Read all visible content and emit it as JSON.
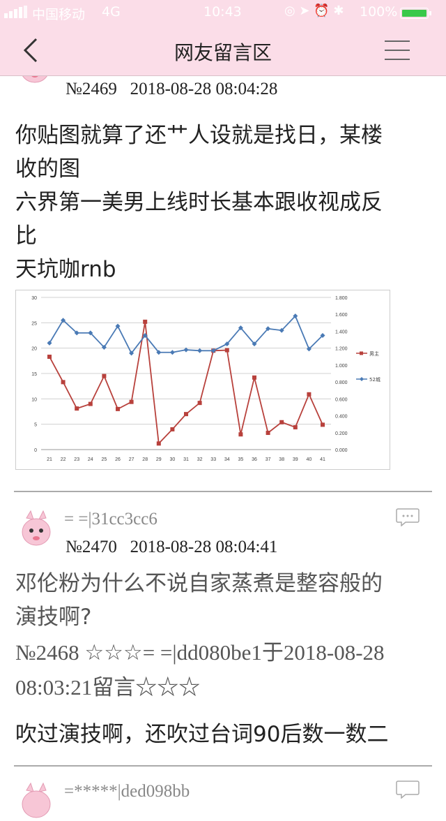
{
  "status_bar": {
    "carrier": "中国移动",
    "network": "4G",
    "time": "10:43",
    "battery": "100%"
  },
  "nav": {
    "title": "网友留言区",
    "back_icon": "chevron-left-icon",
    "menu_icon": "hamburger-menu-icon"
  },
  "posts": [
    {
      "number": "№2469",
      "timestamp": "2018-08-28 08:04:28",
      "lines": [
        "你贴图就算了还艹人设就是找日，某楼",
        "收的图",
        "六界第一美男上线时长基本跟收视成反",
        "比",
        "天坑咖rnb"
      ]
    },
    {
      "user": "= =|31cc3cc6",
      "number": "№2470",
      "timestamp": "2018-08-28 08:04:41",
      "lines": [
        "邓伦粉为什么不说自家蒸煮是整容般的",
        "演技啊?"
      ],
      "quote_lines": [
        "№2468 ☆☆☆= =|dd080be1于2018-08-28",
        "08:03:21留言☆☆☆"
      ],
      "reply": "吹过演技啊，还吹过台词90后数一数二"
    },
    {
      "user": "=*****|ded098bb"
    }
  ],
  "colors": {
    "header_bg": "#fbdde8",
    "series_male": "#b8413c",
    "series_52": "#4a7ab5"
  },
  "chart_data": {
    "type": "line",
    "x": [
      21,
      22,
      23,
      24,
      25,
      26,
      27,
      28,
      29,
      30,
      31,
      32,
      33,
      34,
      35,
      36,
      37,
      38,
      39,
      40,
      41
    ],
    "x_tick_labels": [
      "21",
      "22",
      "23",
      "24",
      "25",
      "26",
      "27",
      "28",
      "29",
      "30",
      "31",
      "32",
      "33",
      "34",
      "35",
      "36",
      "37",
      "38",
      "39",
      "40",
      "41"
    ],
    "y_left_ticks": [
      "30",
      "25",
      "20",
      "15",
      "10",
      "5",
      "0"
    ],
    "y_right_ticks": [
      "1.800",
      "1.600",
      "1.400",
      "1.200",
      "1.000",
      "0.800",
      "0.600",
      "0.400",
      "0.200",
      "0.000"
    ],
    "ylim_left": [
      0,
      30
    ],
    "ylim_right": [
      0,
      1.8
    ],
    "grid": true,
    "legend_position": "right",
    "series": [
      {
        "name": "男主",
        "axis": "left",
        "color": "#b8413c",
        "marker": "square",
        "values": [
          18.3,
          13.3,
          8.1,
          9.0,
          14.5,
          8.0,
          9.4,
          25.2,
          1.2,
          4.0,
          7.0,
          9.2,
          19.5,
          19.6,
          3.0,
          14.2,
          3.3,
          5.4,
          4.4,
          10.9,
          4.9
        ]
      },
      {
        "name": "52城",
        "axis": "right",
        "color": "#4a7ab5",
        "marker": "diamond",
        "values": [
          1.26,
          1.53,
          1.38,
          1.38,
          1.21,
          1.46,
          1.14,
          1.35,
          1.15,
          1.15,
          1.18,
          1.17,
          1.17,
          1.25,
          1.44,
          1.25,
          1.43,
          1.41,
          1.58,
          1.19,
          1.35
        ]
      }
    ]
  }
}
